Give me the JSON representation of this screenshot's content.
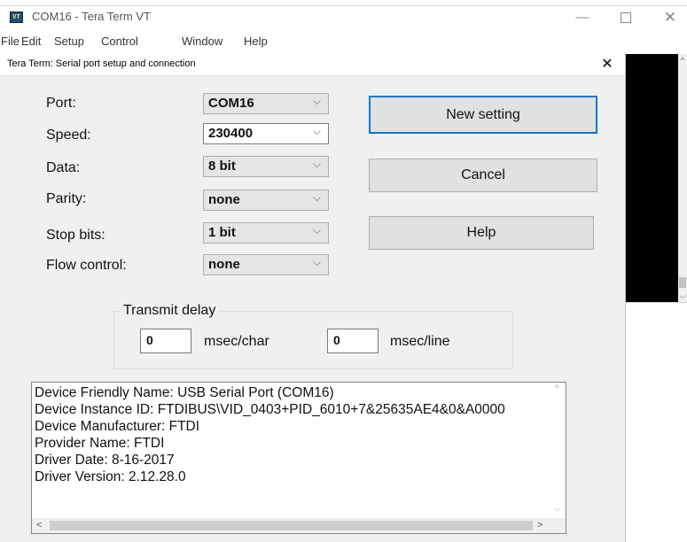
{
  "window": {
    "title": "COM16 - Tera Term VT",
    "icon": "tera-term-app-icon",
    "icon_text": "VT",
    "controls": {
      "minimize": "—",
      "close": "✕"
    }
  },
  "menu": [
    "File",
    "Edit",
    "Setup",
    "Control",
    "Window",
    "Help"
  ],
  "dialog": {
    "title": "Tera Term: Serial port setup and connection",
    "close": "✕",
    "fields": {
      "port": {
        "label": "Port:",
        "value": "COM16"
      },
      "speed": {
        "label": "Speed:",
        "value": "230400"
      },
      "data": {
        "label": "Data:",
        "value": "8 bit"
      },
      "parity": {
        "label": "Parity:",
        "value": "none"
      },
      "stop_bits": {
        "label": "Stop bits:",
        "value": "1 bit"
      },
      "flow_control": {
        "label": "Flow control:",
        "value": "none"
      }
    },
    "dropdown_arrow": "⌵",
    "buttons": {
      "new_setting": "New setting",
      "cancel": "Cancel",
      "help": "Help"
    },
    "transmit_delay": {
      "legend": "Transmit delay",
      "char_value": "0",
      "char_unit": "msec/char",
      "line_value": "0",
      "line_unit": "msec/line"
    },
    "info_lines": [
      "Device Friendly Name: USB Serial Port (COM16)",
      "Device Instance ID: FTDIBUS\\VID_0403+PID_6010+7&25635AE4&0&A0000",
      "Device Manufacturer: FTDI",
      "Provider Name: FTDI",
      "Driver Date: 8-16-2017",
      "Driver Version: 2.12.28.0"
    ],
    "scroll_arrows": {
      "up": "^",
      "down": "⌵",
      "left": "<",
      "right": ">"
    }
  },
  "colors": {
    "default_button_border": "#0078d7",
    "terminal_bg": "#000000",
    "dialog_bg": "#f0f0f0"
  }
}
